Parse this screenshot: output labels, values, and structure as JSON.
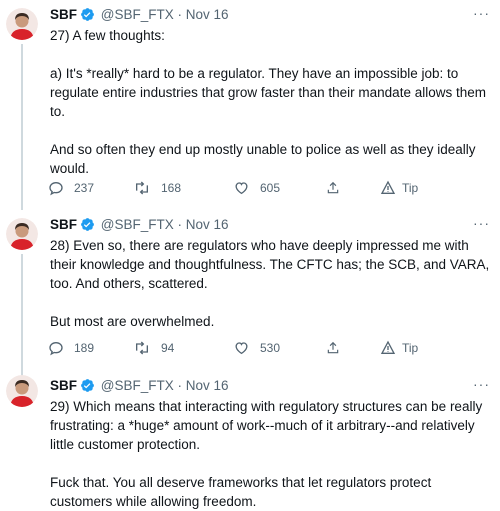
{
  "author": {
    "name": "SBF",
    "handle": "@SBF_FTX",
    "separator": "·",
    "date": "Nov 16",
    "verified_color": "#1d9bf0",
    "avatar_color": "#d8232a"
  },
  "more_label": "···",
  "tweets": [
    {
      "paragraphs": [
        "27) A few thoughts:",
        "a) It's *really* hard to be a regulator.  They have an impossible job: to regulate entire industries that grow faster than their mandate allows them to.",
        "And so often they end up mostly unable to police as well as they ideally would."
      ],
      "replies": "237",
      "retweets": "168",
      "likes": "605",
      "tip_label": "Tip"
    },
    {
      "paragraphs": [
        "28) Even so, there are regulators who have deeply impressed me with their knowledge and thoughtfulness.  The CFTC has; the SCB, and VARA, too.  And others, scattered.",
        "But most are overwhelmed."
      ],
      "replies": "189",
      "retweets": "94",
      "likes": "530",
      "tip_label": "Tip"
    },
    {
      "paragraphs": [
        "29) Which means that interacting with regulatory structures can be really frustrating: a *huge* amount of work--much of it arbitrary--and relatively little customer protection.",
        "Fuck that.  You all deserve frameworks that let regulators protect customers while allowing freedom."
      ]
    }
  ]
}
